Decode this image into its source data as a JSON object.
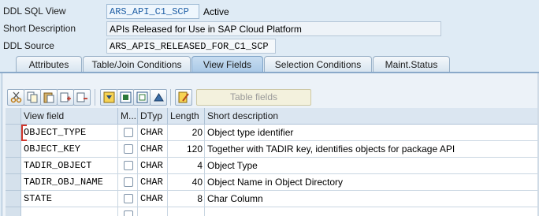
{
  "header": {
    "ddl_sql_view_label": "DDL SQL View",
    "ddl_sql_view_value": "ARS_API_C1_SCP",
    "status": "Active",
    "short_description_label": "Short Description",
    "short_description_value": "APIs Released for Use in SAP Cloud Platform",
    "ddl_source_label": "DDL Source",
    "ddl_source_value": "ARS_APIS_RELEASED_FOR_C1_SCP"
  },
  "tabs": [
    {
      "label": "Attributes",
      "active": false
    },
    {
      "label": "Table/Join Conditions",
      "active": false
    },
    {
      "label": "View Fields",
      "active": true
    },
    {
      "label": "Selection Conditions",
      "active": false
    },
    {
      "label": "Maint.Status",
      "active": false
    }
  ],
  "toolbar": {
    "table_fields_label": "Table fields",
    "icons": [
      "cut-icon",
      "copy-icon",
      "paste-icon",
      "insert-row-icon",
      "delete-row-icon",
      "choose-icon",
      "select-all-icon",
      "deselect-all-icon",
      "sort-icon",
      "edit-pencil-icon"
    ]
  },
  "grid": {
    "columns": [
      "View field",
      "M...",
      "DTyp",
      "Length",
      "Short description"
    ],
    "rows": [
      {
        "field": "OBJECT_TYPE",
        "dtyp": "CHAR",
        "length": "20",
        "desc": "Object type identifier"
      },
      {
        "field": "OBJECT_KEY",
        "dtyp": "CHAR",
        "length": "120",
        "desc": "Together with TADIR key, identifies objects for package API"
      },
      {
        "field": "TADIR_OBJECT",
        "dtyp": "CHAR",
        "length": "4",
        "desc": "Object Type"
      },
      {
        "field": "TADIR_OBJ_NAME",
        "dtyp": "CHAR",
        "length": "40",
        "desc": "Object Name in Object Directory"
      },
      {
        "field": "STATE",
        "dtyp": "CHAR",
        "length": "8",
        "desc": "Char Column"
      },
      {
        "field": "",
        "dtyp": "",
        "length": "",
        "desc": ""
      }
    ]
  },
  "colors": {
    "background": "#dfebf5",
    "active_tab": "#a9c8e6",
    "focus_marker": "#d1352b",
    "link_text": "#1f5fa5"
  }
}
